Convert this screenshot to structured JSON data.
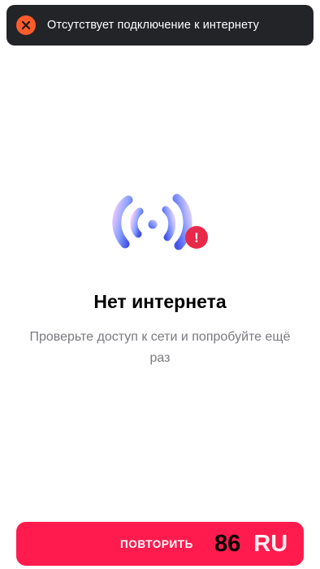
{
  "toast": {
    "icon": "close-circle-icon",
    "message": "Отсутствует подключение к интернету",
    "accent": "#ff5b2b"
  },
  "illustration": {
    "icon": "wifi-error-icon",
    "badge": "!",
    "badge_color": "#e8294a"
  },
  "content": {
    "title": "Нет интернета",
    "subtitle": "Проверьте доступ к сети и попробуйте ещё раз"
  },
  "actions": {
    "retry_label": "ПОВТОРИТЬ",
    "button_color": "#ff1b4d"
  },
  "watermark": {
    "number": "86",
    "suffix": "RU"
  }
}
